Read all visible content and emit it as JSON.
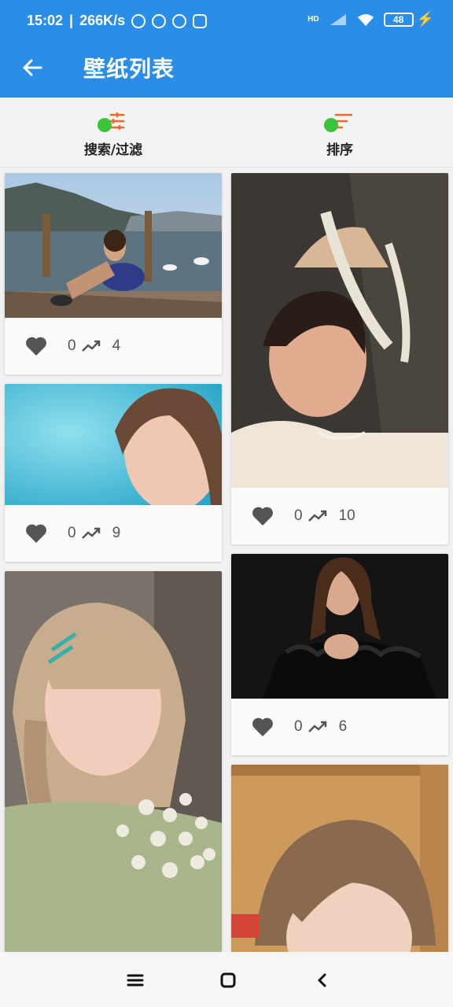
{
  "status": {
    "time": "15:02",
    "speed": "266K/s",
    "hd": "HD",
    "battery": "48"
  },
  "header": {
    "title": "壁纸列表",
    "back_icon": "arrow-left-icon"
  },
  "filters": {
    "search_label": "搜索/过滤",
    "sort_label": "排序"
  },
  "cards": [
    {
      "likes": "0",
      "views": "4"
    },
    {
      "likes": "0",
      "views": "10"
    },
    {
      "likes": "0",
      "views": "9"
    },
    {
      "likes": "0",
      "views": "6"
    }
  ],
  "colors": {
    "primary": "#2a8ee8",
    "accent_orange": "#ee6a2a",
    "check_green": "#3ac43a"
  }
}
